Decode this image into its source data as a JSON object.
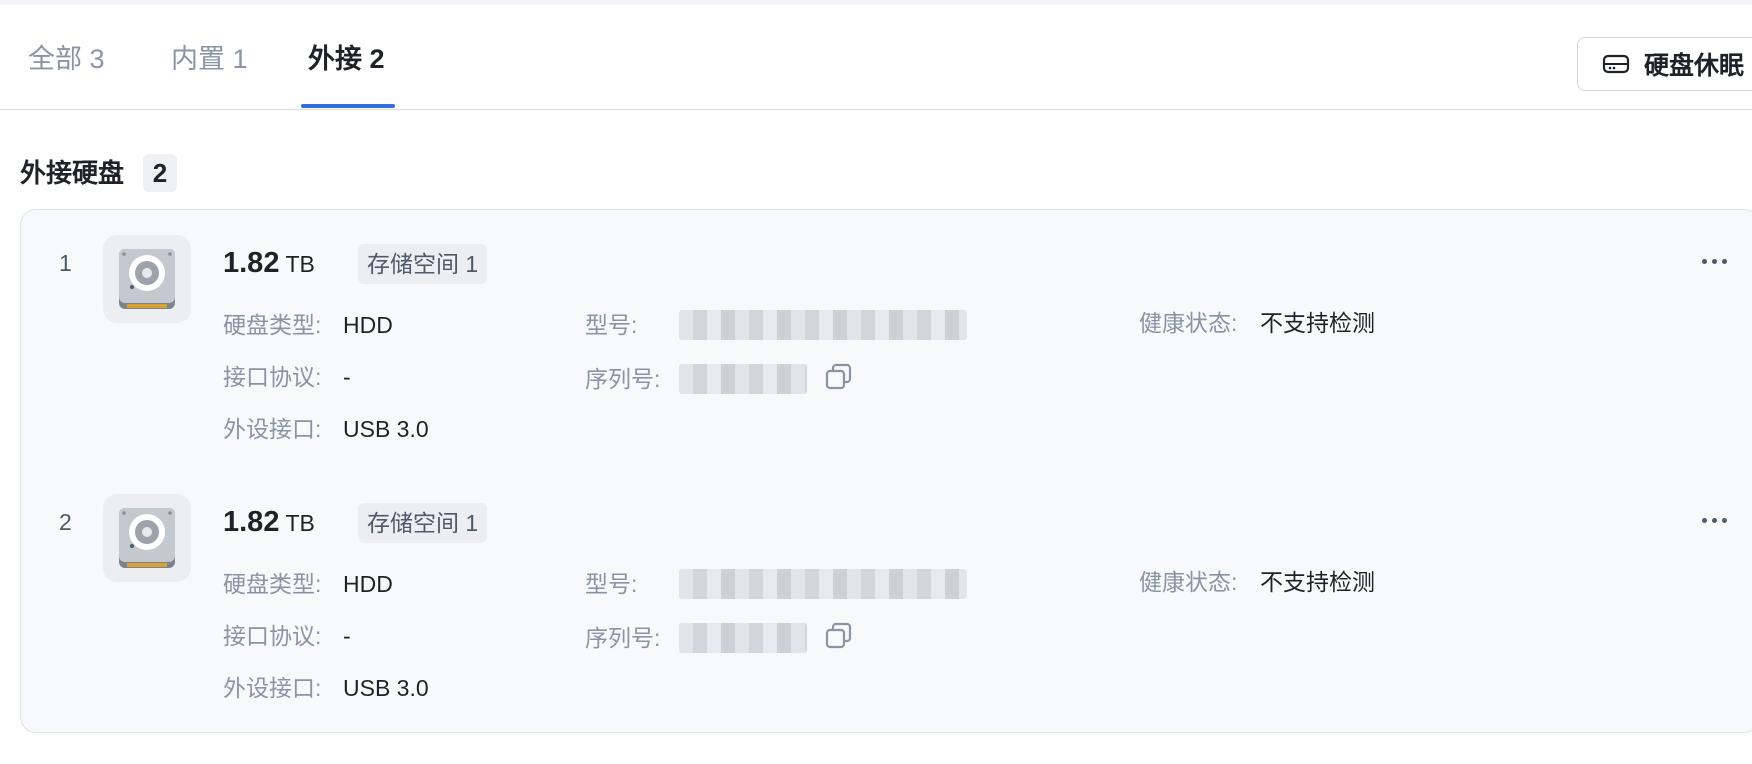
{
  "tabs": [
    {
      "label": "全部 3"
    },
    {
      "label": "内置 1"
    },
    {
      "label": "外接 2"
    }
  ],
  "toolbar": {
    "sleep_label": "硬盘休眠"
  },
  "section": {
    "title": "外接硬盘",
    "count": "2"
  },
  "labels": {
    "disk_type": "硬盘类型:",
    "interface": "接口协议:",
    "external_port": "外设接口:",
    "model": "型号:",
    "serial": "序列号:",
    "health": "健康状态:"
  },
  "disks": [
    {
      "index": "1",
      "capacity": "1.82",
      "unit": "TB",
      "pool": "存储空间 1",
      "disk_type": "HDD",
      "interface": "-",
      "external_port": "USB 3.0",
      "health": "不支持检测"
    },
    {
      "index": "2",
      "capacity": "1.82",
      "unit": "TB",
      "pool": "存储空间 1",
      "disk_type": "HDD",
      "interface": "-",
      "external_port": "USB 3.0",
      "health": "不支持检测"
    }
  ],
  "colors": {
    "accent": "#2f6fde",
    "card_bg": "#f8f9fb",
    "muted_text": "#8a94a6"
  }
}
